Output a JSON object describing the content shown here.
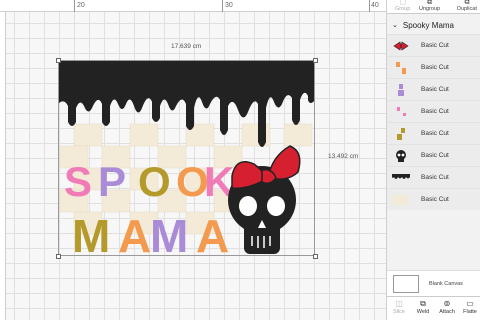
{
  "ruler": {
    "marks": [
      "20",
      "30",
      "40"
    ]
  },
  "dimensions": {
    "width": "17.639 cm",
    "height": "13.492 cm"
  },
  "toolbar": {
    "group": "Group",
    "ungroup": "Ungroup",
    "duplicate": "Duplicat"
  },
  "layers_panel": {
    "group_title": "Spooky Mama",
    "items": [
      {
        "label": "Basic Cut",
        "thumb": "red-bow"
      },
      {
        "label": "Basic Cut",
        "thumb": "orange-shapes"
      },
      {
        "label": "Basic Cut",
        "thumb": "purple-shapes"
      },
      {
        "label": "Basic Cut",
        "thumb": "pink-shapes"
      },
      {
        "label": "Basic Cut",
        "thumb": "olive-shapes"
      },
      {
        "label": "Basic Cut",
        "thumb": "black-skull"
      },
      {
        "label": "Basic Cut",
        "thumb": "black-drip"
      },
      {
        "label": "Basic Cut",
        "thumb": "beige-check"
      }
    ]
  },
  "blank_canvas": {
    "label": "Blank Canvas"
  },
  "bottom_actions": {
    "slice": "Slice",
    "weld": "Weld",
    "attach": "Attach",
    "flatten": "Flatte"
  },
  "colors": {
    "pink": "#f07bb7",
    "orange": "#f39a4e",
    "purple": "#a98bd6",
    "olive": "#b49a2a",
    "black": "#222222",
    "red": "#d7202f",
    "beige": "#f3ead7"
  },
  "artwork": {
    "text_top": "SPOOKY",
    "text_bottom": "MAMA"
  }
}
